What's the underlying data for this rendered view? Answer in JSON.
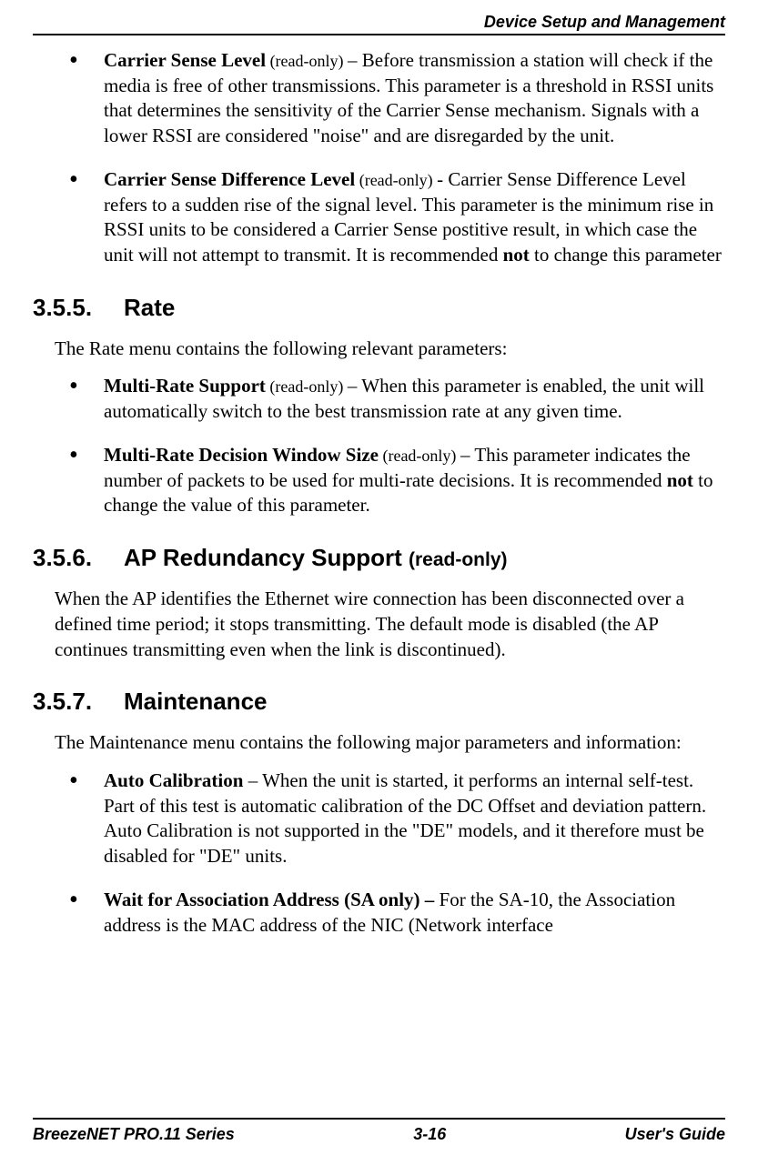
{
  "header": {
    "title": "Device Setup and Management"
  },
  "body": {
    "top_bullets": [
      {
        "term": "Carrier Sense Level",
        "ro": " (read-only) ",
        "sep": "– ",
        "text": "Before transmission a station will check if the media is free of other transmissions. This parameter is a threshold in RSSI units that determines the sensitivity of the Carrier Sense mechanism. Signals with a lower RSSI are considered \"noise\" and are disregarded by the unit."
      },
      {
        "term": "Carrier Sense Difference Level",
        "ro": " (read-only) ",
        "sep": "- ",
        "pre": "Carrier Sense Difference Level refers to a sudden rise of the signal level. This parameter is the minimum rise in RSSI units to be considered a Carrier Sense postitive result, in which case the unit will not attempt to transmit. It is recommended ",
        "strong": "not",
        "post": " to change this parameter"
      }
    ],
    "s355": {
      "num": "3.5.5.",
      "title": "Rate",
      "intro": "The Rate menu contains the following relevant parameters:",
      "bullets": [
        {
          "term": "Multi-Rate Support",
          "ro": " (read-only) ",
          "sep": "– ",
          "text": "When this parameter is enabled, the unit will automatically switch to the best transmission rate at any given time."
        },
        {
          "term": "Multi-Rate Decision Window Size",
          "ro": " (read-only) ",
          "sep": "– ",
          "pre": "This parameter indicates the number of packets to be used for multi-rate decisions. It is recommended ",
          "strong": "not",
          "post": " to change the value of this parameter."
        }
      ]
    },
    "s356": {
      "num": "3.5.6.",
      "title": "AP Redundancy Support ",
      "ro": "(read-only)",
      "para": "When the AP identifies the Ethernet wire connection has been disconnected over a defined time period; it stops transmitting. The default mode is disabled (the AP continues transmitting even when the link is discontinued)."
    },
    "s357": {
      "num": "3.5.7.",
      "title": "Maintenance",
      "intro": "The Maintenance menu contains the following major parameters and information:",
      "bullets": [
        {
          "term": "Auto Calibration ",
          "sep": " – ",
          "text": "When the unit is started, it performs an internal self-test. Part of this test is automatic calibration of the DC Offset and deviation pattern. Auto Calibration is not supported in the \"DE\" models, and it therefore must be disabled for \"DE\" units."
        },
        {
          "term": "Wait for Association Address  (SA only) – ",
          "text": "For the SA-10, the Association address is the MAC address of the NIC (Network interface"
        }
      ]
    }
  },
  "footer": {
    "left": "BreezeNET PRO.11 Series",
    "center": "3-16",
    "right": "User's Guide"
  }
}
